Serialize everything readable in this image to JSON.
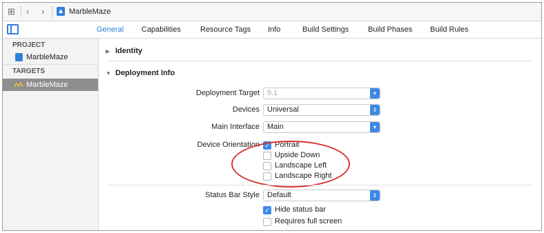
{
  "toolbar": {
    "grid_icon": "grid-icon",
    "back_icon": "chevron-left-icon",
    "forward_icon": "chevron-right-icon",
    "breadcrumb_project": "MarbleMaze"
  },
  "tabs": [
    {
      "label": "General",
      "active": true
    },
    {
      "label": "Capabilities"
    },
    {
      "label": "Resource Tags"
    },
    {
      "label": "Info"
    },
    {
      "label": "Build Settings"
    },
    {
      "label": "Build Phases"
    },
    {
      "label": "Build Rules"
    }
  ],
  "sidebar": {
    "project_heading": "PROJECT",
    "project_item": "MarbleMaze",
    "targets_heading": "TARGETS",
    "target_item": "MarbleMaze"
  },
  "main": {
    "identity_title": "Identity",
    "deployment_title": "Deployment Info",
    "deployment_target_label": "Deployment Target",
    "deployment_target_value": "9.1",
    "devices_label": "Devices",
    "devices_value": "Universal",
    "main_interface_label": "Main Interface",
    "main_interface_value": "Main",
    "device_orientation_label": "Device Orientation",
    "orientations": [
      {
        "label": "Portrait",
        "checked": true
      },
      {
        "label": "Upside Down",
        "checked": false
      },
      {
        "label": "Landscape Left",
        "checked": false
      },
      {
        "label": "Landscape Right",
        "checked": false
      }
    ],
    "status_bar_style_label": "Status Bar Style",
    "status_bar_style_value": "Default",
    "hide_status_bar": {
      "label": "Hide status bar",
      "checked": true
    },
    "requires_full_screen": {
      "label": "Requires full screen",
      "checked": false
    }
  },
  "colors": {
    "accent": "#2f7fd8",
    "annotation": "#d8322e",
    "sidebar_selection": "#8e8e8e"
  }
}
